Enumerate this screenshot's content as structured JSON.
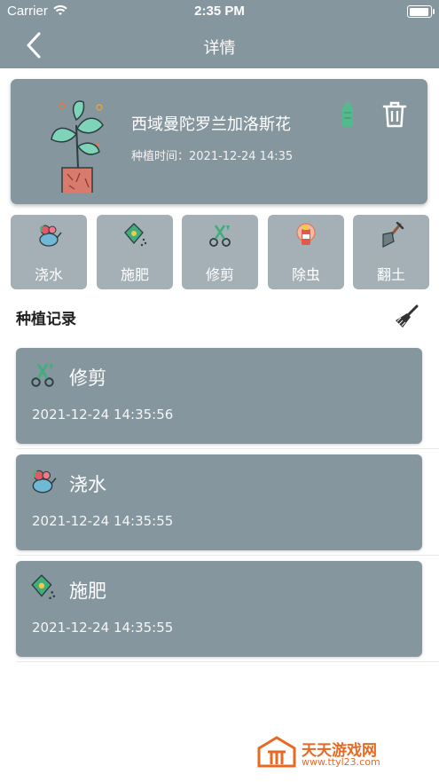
{
  "status_bar": {
    "carrier": "Carrier",
    "time": "2:35 PM"
  },
  "nav": {
    "title": "详情",
    "back_icon": "chevron-left-icon"
  },
  "plant": {
    "name": "西域曼陀罗兰加洛斯花",
    "plant_time": "种植时间：2021-12-24 14:35"
  },
  "actions": [
    {
      "label": "浇水",
      "icon": "watering-can-icon"
    },
    {
      "label": "施肥",
      "icon": "fertilizer-bag-icon"
    },
    {
      "label": "修剪",
      "icon": "pruning-shears-icon"
    },
    {
      "label": "除虫",
      "icon": "pest-spray-icon"
    },
    {
      "label": "翻土",
      "icon": "shovel-icon"
    }
  ],
  "records_section": {
    "title": "种植记录",
    "clear_icon": "broom-icon"
  },
  "records": [
    {
      "name": "修剪",
      "time": "2021-12-24 14:35:56",
      "icon": "pruning-shears-icon"
    },
    {
      "name": "浇水",
      "time": "2021-12-24 14:35:55",
      "icon": "watering-can-icon"
    },
    {
      "name": "施肥",
      "time": "2021-12-24 14:35:55",
      "icon": "fertilizer-bag-icon"
    }
  ],
  "watermark": {
    "name": "天天游戏网",
    "url": "www.ttyl23.com"
  },
  "colors": {
    "header": "#86969e",
    "card": "#86969e",
    "action_tile": "#a5b0b6",
    "watermark": "#e66a23"
  }
}
